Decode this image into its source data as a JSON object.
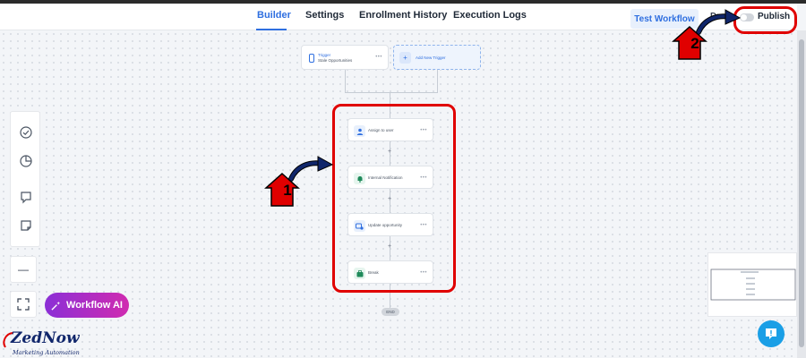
{
  "header": {
    "tabs": [
      {
        "label": "Builder",
        "active": true
      },
      {
        "label": "Settings",
        "active": false
      },
      {
        "label": "Enrollment History",
        "active": false
      },
      {
        "label": "Execution Logs",
        "active": false
      }
    ],
    "test_workflow_label": "Test Workflow",
    "draft_label": "Draft",
    "publish_label": "Publish",
    "published": false
  },
  "workflow": {
    "trigger": {
      "title": "Trigger",
      "subtitle": "Stale Opportunities"
    },
    "add_trigger_label": "Add New Trigger",
    "actions": [
      {
        "label": "Assign to user",
        "icon": "user-icon"
      },
      {
        "label": "Internal Notification",
        "icon": "bell-icon"
      },
      {
        "label": "Update opportunity",
        "icon": "opportunity-icon"
      },
      {
        "label": "Break",
        "icon": "break-icon"
      }
    ],
    "add_step_symbol": "+",
    "end_label": "END"
  },
  "sidebar": {
    "tools": [
      "check-circle-icon",
      "pie-chart-icon",
      "comment-icon",
      "sticky-note-icon"
    ],
    "zoom_out_symbol": "—"
  },
  "workflow_ai_label": "Workflow AI",
  "annotations": {
    "step_1": "1",
    "step_2": "2",
    "highlight_color": "#e00000"
  },
  "watermark": {
    "brand": "ZedNow",
    "tagline": "Marketing Automation"
  },
  "colors": {
    "accent": "#2f6fe0",
    "ai_gradient_start": "#8b2fd6",
    "ai_gradient_end": "#d02bb0",
    "help": "#1a9fe6"
  }
}
